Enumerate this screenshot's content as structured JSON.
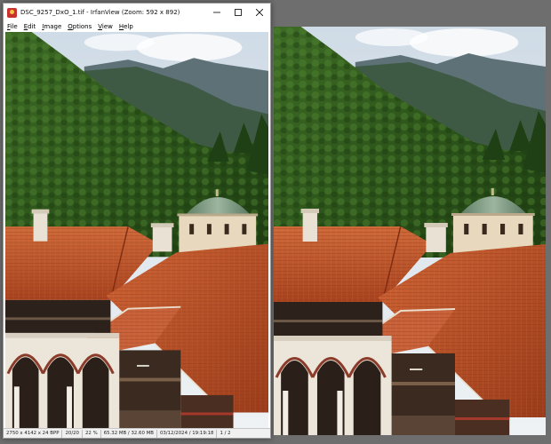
{
  "window": {
    "title": "DSC_9257_DxO_1.tif - IrfanView (Zoom: 592 x 892)",
    "controls": {
      "minimize": "minimize-icon",
      "maximize": "maximize-icon",
      "close": "close-icon"
    }
  },
  "menu": {
    "items": [
      {
        "first": "F",
        "rest": "ile"
      },
      {
        "first": "E",
        "rest": "dit"
      },
      {
        "first": "I",
        "rest": "mage"
      },
      {
        "first": "O",
        "rest": "ptions"
      },
      {
        "first": "V",
        "rest": "iew"
      },
      {
        "first": "H",
        "rest": "elp"
      }
    ]
  },
  "status": {
    "dimensions": "2750 x 4142 x 24 BPP",
    "index": "20/20",
    "zoom": "22 %",
    "size": "65.32 MB / 32.60 MB",
    "datetime": "03/12/2024 / 19:19:18",
    "page": "1 / 2"
  },
  "colors": {
    "roof": "#c2542c",
    "roof_shadow": "#8f3518",
    "forest": "#2e5a1f",
    "forest_light": "#5f8f35",
    "sky": "#dfe8ef",
    "mountain": "#5d7177",
    "dome": "#7a9a7e"
  }
}
